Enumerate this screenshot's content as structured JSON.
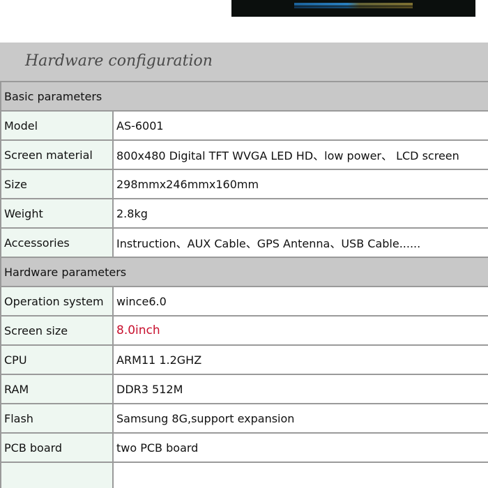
{
  "section": {
    "title": "Hardware configuration"
  },
  "groups": [
    {
      "header": "Basic parameters",
      "rows": [
        {
          "label": "Model",
          "value": "AS-6001"
        },
        {
          "label": "Screen material",
          "value": "800x480 Digital TFT WVGA LED HD、low power、 LCD screen"
        },
        {
          "label": "Size",
          "value": "298mmx246mmx160mm"
        },
        {
          "label": "Weight",
          "value": "2.8kg"
        },
        {
          "label": "Accessories",
          "value": "Instruction、AUX Cable、GPS Antenna、USB Cable......"
        }
      ]
    },
    {
      "header": "Hardware parameters",
      "rows": [
        {
          "label": "Operation system",
          "value": "wince6.0"
        },
        {
          "label": "Screen size",
          "value": "8.0inch",
          "highlight": "#c8102e"
        },
        {
          "label": "CPU",
          "value": "ARM11  1.2GHZ"
        },
        {
          "label": "RAM",
          "value": "DDR3 512M"
        },
        {
          "label": "Flash",
          "value": "Samsung 8G,support expansion"
        },
        {
          "label": "PCB board",
          "value": "two PCB board"
        }
      ]
    }
  ],
  "colors": {
    "banner_bg": "#c9c9c9",
    "header_row_bg": "#c8c8c8",
    "label_cell_bg": "#eef7f1",
    "border": "#9a9a9a",
    "highlight_text": "#c8102e"
  }
}
